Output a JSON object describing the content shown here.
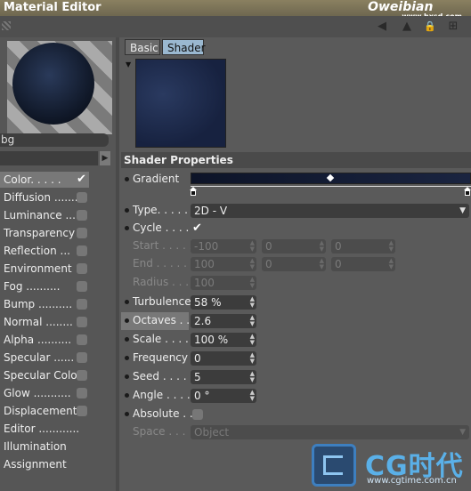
{
  "window": {
    "title": "Material Editor",
    "watermark": "Oweibian",
    "watermark_sub": "www.hxsd.com"
  },
  "toolbar": {
    "nav_icons": [
      "left-arrow-icon",
      "up-arrow-icon",
      "lock-icon",
      "new-window-icon"
    ],
    "nav_glyphs": [
      "◀",
      "▲",
      "🔒",
      "⊞"
    ]
  },
  "material": {
    "name": "bg"
  },
  "channels": [
    {
      "label": "Color",
      "checked": true,
      "selected": true
    },
    {
      "label": "Diffusion",
      "dots": ".........",
      "checked": false
    },
    {
      "label": "Luminance",
      "dots": "...",
      "checked": false
    },
    {
      "label": "Transparency",
      "dots": "",
      "checked": false
    },
    {
      "label": "Reflection",
      "dots": "...",
      "checked": false
    },
    {
      "label": "Environment",
      "dots": "",
      "checked": false
    },
    {
      "label": "Fog",
      "dots": "..........",
      "checked": false
    },
    {
      "label": "Bump",
      "dots": "..........",
      "checked": false
    },
    {
      "label": "Normal",
      "dots": "........",
      "checked": false
    },
    {
      "label": "Alpha",
      "dots": "..........",
      "checked": false
    },
    {
      "label": "Specular",
      "dots": "......",
      "checked": false
    },
    {
      "label": "Specular Color",
      "dots": "",
      "checked": false
    },
    {
      "label": "Glow",
      "dots": "...........",
      "checked": false
    },
    {
      "label": "Displacement",
      "dots": "",
      "checked": false
    },
    {
      "label": "Editor",
      "dots": "............",
      "checkbox": false
    },
    {
      "label": "Illumination",
      "dots": "",
      "checkbox": false
    },
    {
      "label": "Assignment",
      "dots": "",
      "checkbox": false
    }
  ],
  "tabs": [
    {
      "label": "Basic"
    },
    {
      "label": "Shader"
    }
  ],
  "section": {
    "title": "Shader Properties"
  },
  "props": {
    "gradient": {
      "label": "Gradient"
    },
    "type": {
      "label": "Type. . . . . .",
      "value": "2D - V"
    },
    "cycle": {
      "label": "Cycle . . . .",
      "checked": "✔"
    },
    "start": {
      "label": "Start . . . . .",
      "values": [
        "-100",
        "0",
        "0"
      ]
    },
    "end": {
      "label": "End . . . . .",
      "values": [
        "100",
        "0",
        "0"
      ]
    },
    "radius": {
      "label": "Radius . . .",
      "value": "100"
    },
    "turbulence": {
      "label": "Turbulence",
      "value": "58 %"
    },
    "octaves": {
      "label": "Octaves . .",
      "value": "2.6"
    },
    "scale": {
      "label": "Scale . . . .",
      "value": "100 %"
    },
    "frequency": {
      "label": "Frequency",
      "value": "0"
    },
    "seed": {
      "label": "Seed . . . . .",
      "value": "5"
    },
    "angle": {
      "label": "Angle . . . .",
      "value": "0 °"
    },
    "absolute": {
      "label": "Absolute . ."
    },
    "space": {
      "label": "Space . . .",
      "value": "Object"
    }
  },
  "logo": {
    "text": "CG时代",
    "url": "www.cgtime.com.cn"
  },
  "colors": {
    "accent": "#9ab8d0",
    "gradient_start": "#0d1428",
    "gradient_end": "#1a2440",
    "logo_blue": "#5ab0e8"
  }
}
